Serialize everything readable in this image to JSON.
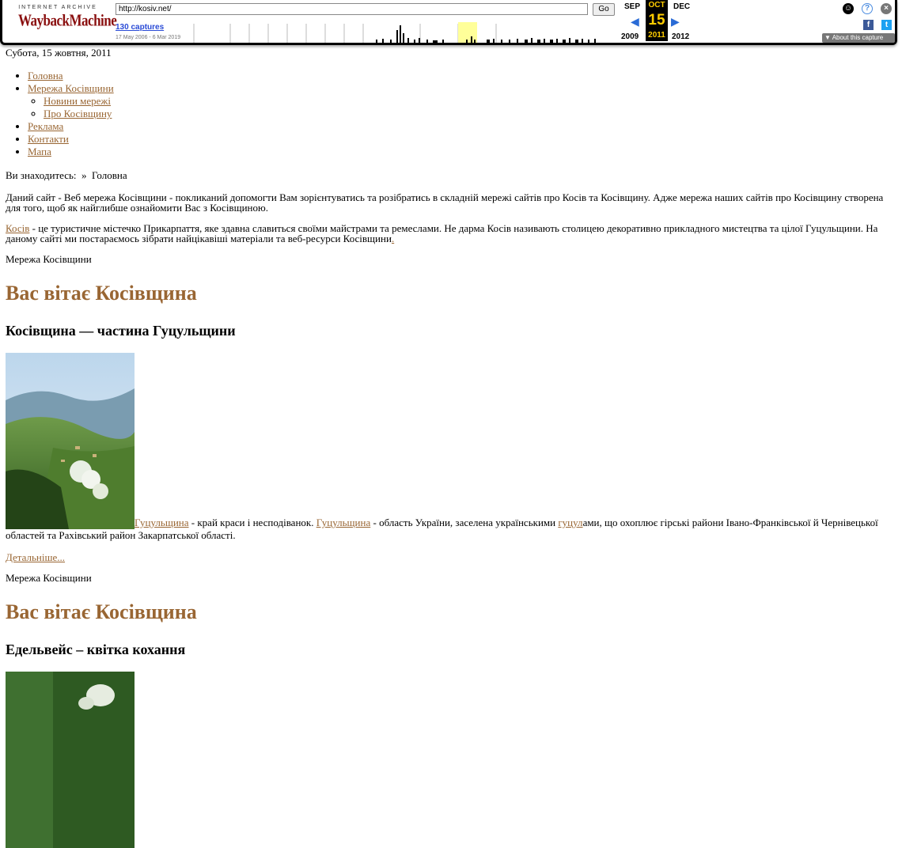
{
  "wayback": {
    "logo_top": "INTERNET ARCHIVE",
    "logo_main": "WaybackMachine",
    "url": "http://kosiv.net/",
    "go_label": "Go",
    "captures": "130 captures",
    "range": "17 May 2006 - 6 Mar 2019",
    "prev_month": "SEP",
    "cur_month": "OCT",
    "next_month": "DEC",
    "cur_day": "15",
    "prev_year": "2009",
    "cur_year": "2011",
    "next_year": "2012",
    "about": "▼ About this capture",
    "icons": [
      "user-icon",
      "help-icon",
      "close-icon",
      "facebook-icon",
      "twitter-icon",
      "prev-arrow-icon",
      "next-arrow-icon"
    ]
  },
  "page": {
    "date": "Субота, 15 жовтня, 2011",
    "menu": [
      {
        "label": "Головна"
      },
      {
        "label": "Мережа Косівщини",
        "children": [
          {
            "label": "Новини мережі"
          },
          {
            "label": "Про Косівщину"
          }
        ]
      },
      {
        "label": "Реклама"
      },
      {
        "label": "Контакти"
      },
      {
        "label": "Мапа"
      }
    ],
    "breadcrumb": {
      "prefix": "Ви знаходитесь:",
      "sep": "»",
      "current": "Головна"
    },
    "intro": "Даний сайт - Веб мережа Косівщини - покликаний допомогти Вам зорієнтуватись та розібратись в складній мережі сайтів про Косів та Косівщину. Адже мережа наших сайтів про Косівщину створена для того, щоб як найглибше ознайомити Вас з Косівщиною.",
    "kosiv_link": "Косів",
    "kosiv_text": " - це туристичне містечко Прикарпаття, яке здавна славиться своїми майстрами та ремеслами. Не дарма Косів називають столицею декоративно прикладного мистецтва та цілої Гуцульщини. На даному сайті ми постараємось зібрати найцікавіші матеріали та веб-ресурси Косівщини",
    "kosiv_tail": ".",
    "articles": [
      {
        "section": "Мережа Косівщини",
        "greeting": "Вас вітає Косівщина",
        "title": "Косівщина — частина Гуцульщини",
        "link1": "Гуцульщина",
        "text1": " - край краси і несподіванок. ",
        "link2": "Гуцульщина",
        "text2": " - область України, заселена українськими ",
        "link3": "гуцул",
        "text3": "ами, що охоплює гірські райони Івано-Франківської й Чернівецької областей та Рахівський район Закарпатської області.",
        "more": "Детальніше..."
      },
      {
        "section": "Мережа Косівщини",
        "greeting": "Вас вітає Косівщина",
        "title": "Едельвейс – квітка кохання"
      }
    ]
  }
}
